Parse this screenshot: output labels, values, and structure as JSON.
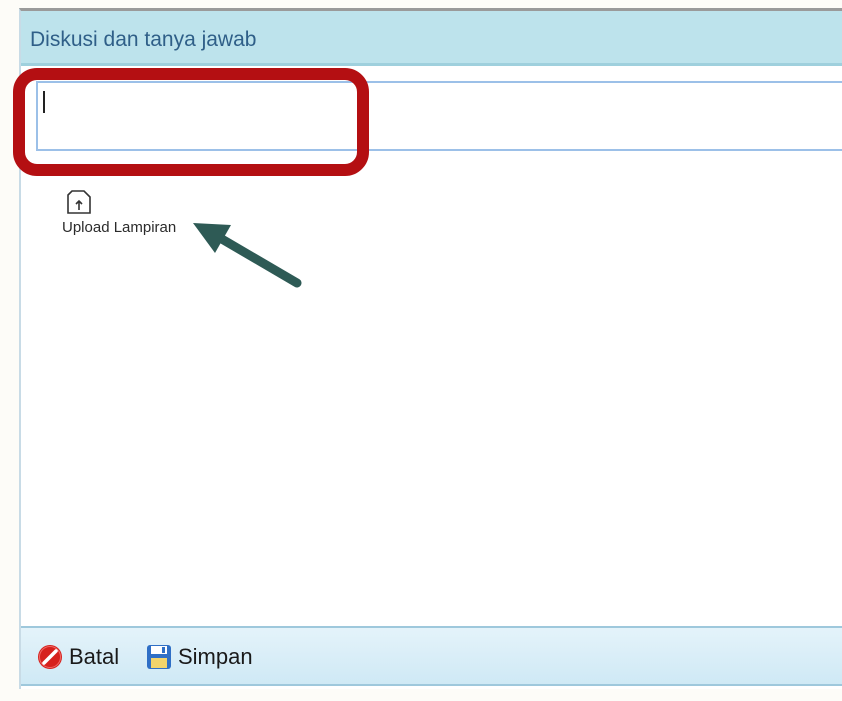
{
  "title": "Diskusi dan tanya jawab",
  "input": {
    "value": "",
    "placeholder": ""
  },
  "upload": {
    "label": "Upload Lampiran",
    "icon": "upload-file-icon"
  },
  "footer": {
    "cancel_label": "Batal",
    "cancel_icon": "cancel-icon",
    "save_label": "Simpan",
    "save_icon": "save-icon"
  },
  "colors": {
    "title_bar": "#bde3ec",
    "title_text": "#2f5f88",
    "highlight": "#b40f12",
    "arrow": "#2e5a55",
    "cancel_icon": "#d6211d",
    "save_icon": "#2f6fc6"
  }
}
